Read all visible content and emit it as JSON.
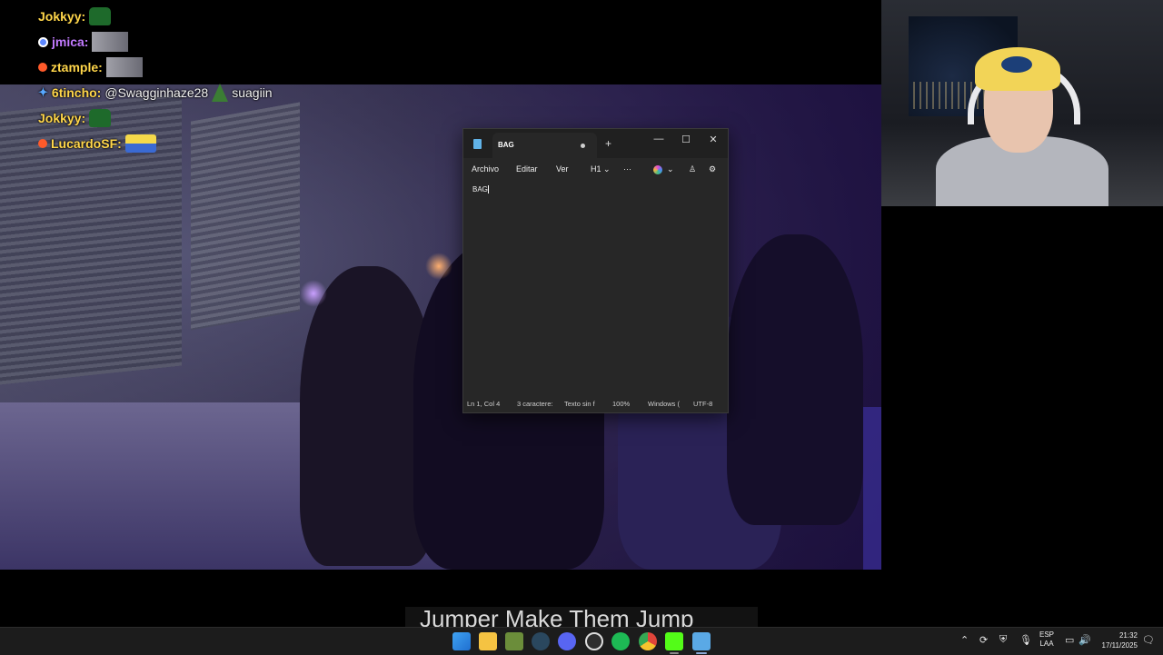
{
  "chat": [
    {
      "user": "Jokkyy:",
      "user_color": "#ffd64a",
      "badge": "",
      "message": "",
      "emote": "green-blob"
    },
    {
      "user": "jmica:",
      "user_color": "#c27aff",
      "badge": "#5c87ff",
      "message": "",
      "emote": "face"
    },
    {
      "user": "ztample:",
      "user_color": "#ffd64a",
      "badge": "#ff5a2a",
      "message": "",
      "emote": "face"
    },
    {
      "user": "6tincho:",
      "user_color": "#ffd64a",
      "badge": "sword",
      "message": "@Swagginhaze28",
      "message2": "suagiin",
      "emote": "tree"
    },
    {
      "user": "Jokkyy:",
      "user_color": "#ffd64a",
      "badge": "",
      "message": "",
      "emote": "green-blob"
    },
    {
      "user": "LucardoSF:",
      "user_color": "#ffd64a",
      "badge": "#ff5a2a",
      "message": "",
      "emote": "taxi"
    }
  ],
  "notepad": {
    "tab_title": "BAG",
    "new_tab": "+",
    "window_buttons": {
      "minimize": "—",
      "maximize": "☐",
      "close": "✕"
    },
    "menu": {
      "file": "Archivo",
      "edit": "Editar",
      "view": "Ver",
      "heading": "H1",
      "more": "···"
    },
    "content": "BAG",
    "status": {
      "position": "Ln 1, Col 4",
      "chars": "3 caractere:",
      "format": "Texto sin f",
      "zoom": "100%",
      "line_ending": "Windows (",
      "encoding": "UTF-8"
    }
  },
  "caption": {
    "text": "Jumper Make Them Jump"
  },
  "taskbar": {
    "apps": [
      {
        "name": "start",
        "color": "#3fa2f2"
      },
      {
        "name": "file-explorer",
        "color": "#f5c342"
      },
      {
        "name": "minecraft",
        "color": "#6b8d3a"
      },
      {
        "name": "steam",
        "color": "#2a475e"
      },
      {
        "name": "discord",
        "color": "#5865f2"
      },
      {
        "name": "obs",
        "color": "#3a3a3a"
      },
      {
        "name": "spotify",
        "color": "#1db954"
      },
      {
        "name": "chrome",
        "color": "#e0453a"
      },
      {
        "name": "kick",
        "color": "#53fc18"
      },
      {
        "name": "notepad",
        "color": "#5aa9e6"
      }
    ],
    "tray": {
      "lang_top": "ESP",
      "lang_bottom": "LAA",
      "time": "21:32",
      "date": "17/11/2025"
    }
  }
}
